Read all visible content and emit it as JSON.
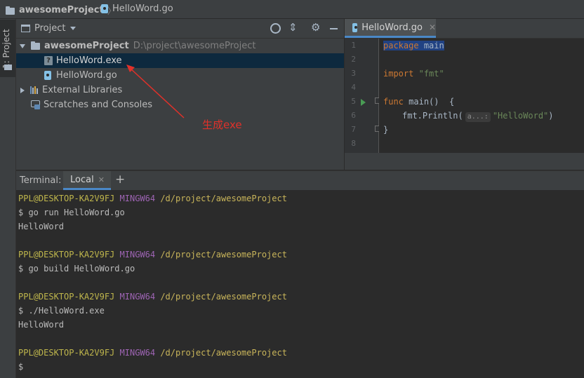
{
  "breadcrumb": {
    "project": "awesomeProject",
    "file": "HelloWord.go"
  },
  "sidebar": {
    "project_tool_label": "1: Project"
  },
  "project_panel": {
    "title": "Project",
    "root": {
      "name": "awesomeProject",
      "path": "D:\\project\\awesomeProject"
    },
    "files": [
      "HelloWord.exe",
      "HelloWord.go"
    ],
    "external_libraries": "External Libraries",
    "scratches": "Scratches and Consoles"
  },
  "annotation": {
    "text": "生成exe",
    "color": "#e0312a"
  },
  "editor": {
    "tab_label": "HelloWord.go",
    "line_numbers": [
      "1",
      "2",
      "3",
      "4",
      "5",
      "6",
      "7",
      "8"
    ],
    "code": {
      "kw_package": "package",
      "pkg_name": "main",
      "kw_import": "import",
      "import_path": "\"fmt\"",
      "kw_func": "func",
      "func_decl": "main()  {",
      "call": "fmt.Println(",
      "param_hint": "a...:",
      "string_arg": "\"HelloWord\"",
      "call_close": ")",
      "close_brace": "}"
    }
  },
  "terminal": {
    "title": "Terminal:",
    "tab_label": "Local",
    "add_symbol": "+",
    "prompt": {
      "user": "PPL@DESKTOP-KA2V9FJ",
      "host": "MINGW64",
      "path": "/d/project/awesomeProject"
    },
    "commands": [
      "$ go run HelloWord.go",
      "$ go build HelloWord.go",
      "$ ./HelloWord.exe",
      "$"
    ],
    "outputs": [
      "HelloWord",
      "HelloWord"
    ]
  },
  "colors": {
    "keyword": "#cc7832",
    "string": "#6a8759",
    "selection": "#214283",
    "accent": "#4a88c7"
  }
}
